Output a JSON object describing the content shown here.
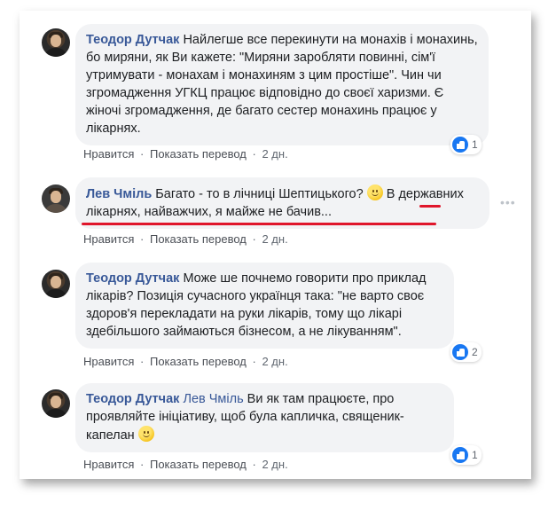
{
  "actions": {
    "like_label": "Нравится",
    "translate_label": "Показать перевод",
    "separator": "·"
  },
  "comments": [
    {
      "author": "Теодор Дутчак",
      "mention": "",
      "text": "Найлегше все перекинути на монахів і монахинь, бо миряни, як Ви кажете: \"Миряни заробляти повинні, сім'ї утримувати - монахам і монахиням з цим простіше\". Чин чи згромадження УГКЦ працює відповідно до своєї харизми. Є жіночі згромадження, де багато сестер монахинь працює у лікарнях.",
      "time": "2 дн.",
      "likes": "1"
    },
    {
      "author": "Лев Чміль",
      "mention": "",
      "text_before": "Багато - то в лічниці Шептицького?",
      "text_after": "В державних лікарнях, найважчих, я майже не бачив...",
      "time": "2 дн.",
      "likes": ""
    },
    {
      "author": "Теодор Дутчак",
      "mention": "",
      "text": "Може ше почнемо говорити про приклад лікарів? Позиція сучасного українця така: \"не варто своє здоров'я перекладати на руки лікарів, тому що лікарі здебільшого займаються бізнесом, а не лікуванням\".",
      "time": "2 дн.",
      "likes": "2"
    },
    {
      "author": "Теодор Дутчак",
      "mention": "Лев Чміль",
      "text": "Ви як там працюєте, про проявляйте ініціативу, щоб була капличка, священик-капелан",
      "time": "2 дн.",
      "likes": "1"
    }
  ],
  "colors": {
    "author": "#385898",
    "bubble": "#f2f3f5",
    "like": "#1877f2",
    "underline": "#e0162b"
  },
  "icons": [
    "like-icon",
    "smiley-icon",
    "more-options-icon"
  ]
}
